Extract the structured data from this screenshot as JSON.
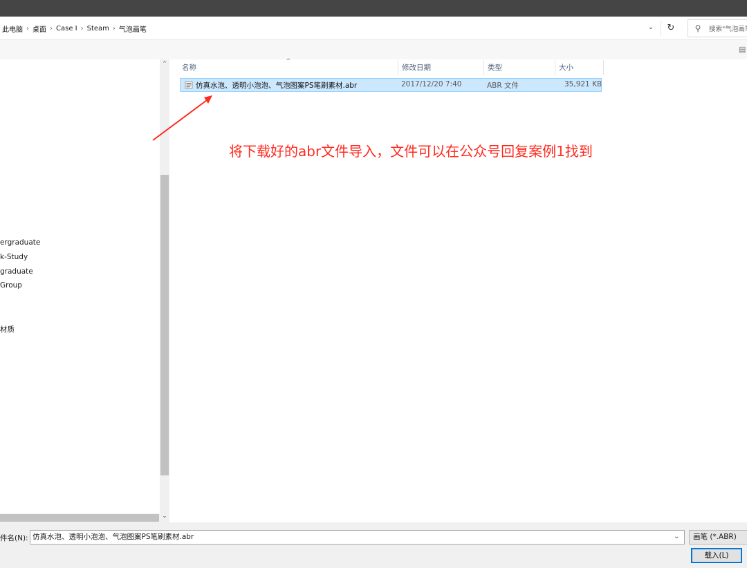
{
  "breadcrumb": [
    "此电脑",
    "桌面",
    "Case I",
    "Steam",
    "气泡画笔"
  ],
  "search": {
    "placeholder": "搜索\"气泡画笔\""
  },
  "nav_items": [
    "ergraduate",
    "k-Study",
    "graduate",
    "Group",
    "材质"
  ],
  "columns": {
    "name": "名称",
    "date": "修改日期",
    "type": "类型",
    "size": "大小"
  },
  "files": [
    {
      "name": "仿真水泡、透明小泡泡、气泡图案PS笔刷素材.abr",
      "date": "2017/12/20 7:40",
      "type": "ABR 文件",
      "size": "35,921 KB",
      "selected": true
    }
  ],
  "annotation": "将下载好的abr文件导入，文件可以在公众号回复案例1找到",
  "footer": {
    "filename_label": "件名(N):",
    "filename_value": "仿真水泡、透明小泡泡、气泡图案PS笔刷素材.abr",
    "filetype_value": "画笔 (*.ABR)",
    "load_button": "载入(L)"
  },
  "colors": {
    "annotation": "#ff2a1f",
    "selection": "#cce8ff",
    "accent": "#0078d7"
  }
}
